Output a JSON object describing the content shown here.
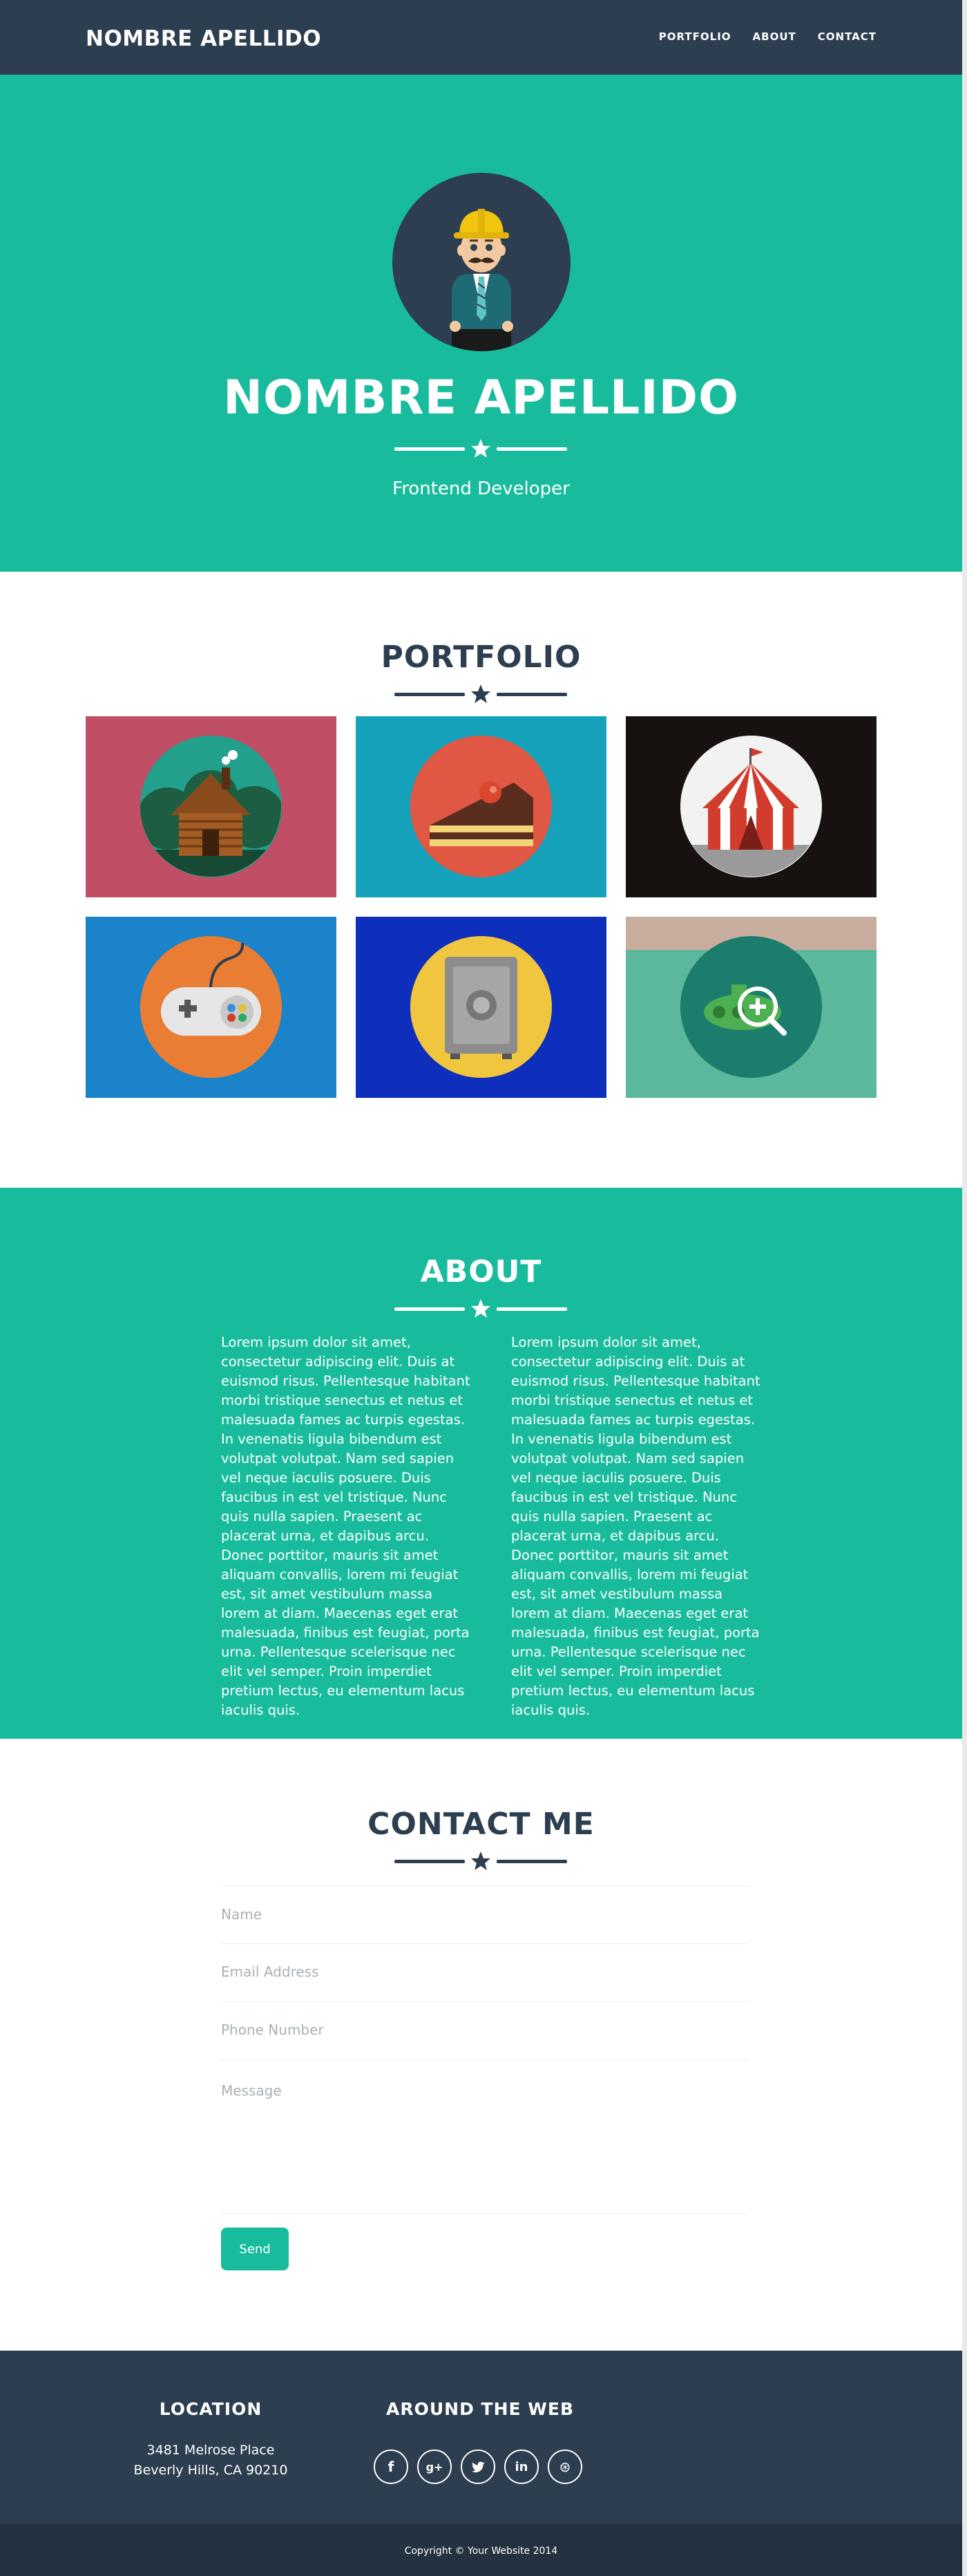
{
  "nav": {
    "brand": "NOMBRE APELLIDO",
    "links": [
      "PORTFOLIO",
      "ABOUT",
      "CONTACT"
    ]
  },
  "hero": {
    "avatar_icon": "developer-avatar-icon",
    "title": "NOMBRE APELLIDO",
    "subtitle": "Frontend Developer"
  },
  "portfolio": {
    "title": "PORTFOLIO",
    "items": [
      {
        "icon": "cabin-icon",
        "bg": "#c04e65",
        "circle": "#22a08c"
      },
      {
        "icon": "cake-icon",
        "bg": "#17a2bb",
        "circle": "#e05744"
      },
      {
        "icon": "circus-tent-icon",
        "bg": "#17120f",
        "circle": "#f2f2f2"
      },
      {
        "icon": "game-controller-icon",
        "bg": "#1a83c9",
        "circle": "#ea7d34"
      },
      {
        "icon": "safe-icon",
        "bg": "#0d2fbb",
        "circle": "#f0c63e"
      },
      {
        "icon": "submarine-icon",
        "bg": "#18bc9c",
        "circle": "#1d7d6c"
      }
    ]
  },
  "about": {
    "title": "ABOUT",
    "col1": "Lorem ipsum dolor sit amet, consectetur adipiscing elit. Duis at euismod risus. Pellentesque habitant morbi tristique senectus et netus et malesuada fames ac turpis egestas. In venenatis ligula bibendum est volutpat volutpat. Nam sed sapien vel neque iaculis posuere. Duis faucibus in est vel tristique. Nunc quis nulla sapien. Praesent ac placerat urna, et dapibus arcu. Donec porttitor, mauris sit amet aliquam convallis, lorem mi feugiat est, sit amet vestibulum massa lorem at diam. Maecenas eget erat malesuada, finibus est feugiat, porta urna. Pellentesque scelerisque nec elit vel semper. Proin imperdiet pretium lectus, eu elementum lacus iaculis quis.",
    "col2": "Lorem ipsum dolor sit amet, consectetur adipiscing elit. Duis at euismod risus. Pellentesque habitant morbi tristique senectus et netus et malesuada fames ac turpis egestas. In venenatis ligula bibendum est volutpat volutpat. Nam sed sapien vel neque iaculis posuere. Duis faucibus in est vel tristique. Nunc quis nulla sapien. Praesent ac placerat urna, et dapibus arcu. Donec porttitor, mauris sit amet aliquam convallis, lorem mi feugiat est, sit amet vestibulum massa lorem at diam. Maecenas eget erat malesuada, finibus est feugiat, porta urna. Pellentesque scelerisque nec elit vel semper. Proin imperdiet pretium lectus, eu elementum lacus iaculis quis."
  },
  "contact": {
    "title": "CONTACT ME",
    "name_placeholder": "Name",
    "email_placeholder": "Email Address",
    "phone_placeholder": "Phone Number",
    "message_placeholder": "Message",
    "send_label": "Send"
  },
  "footer": {
    "location_title": "LOCATION",
    "address_line1": "3481 Melrose Place",
    "address_line2": "Beverly Hills, CA 90210",
    "web_title": "AROUND THE WEB",
    "socials": [
      "facebook-icon",
      "google-plus-icon",
      "twitter-icon",
      "linkedin-icon",
      "dribbble-icon"
    ],
    "social_glyphs": [
      "f",
      "g+",
      "t",
      "in",
      "⊛"
    ],
    "copyright": "Copyright © Your Website 2014"
  },
  "colors": {
    "primary": "#2c3e50",
    "accent": "#18bc9c",
    "white": "#ffffff"
  }
}
